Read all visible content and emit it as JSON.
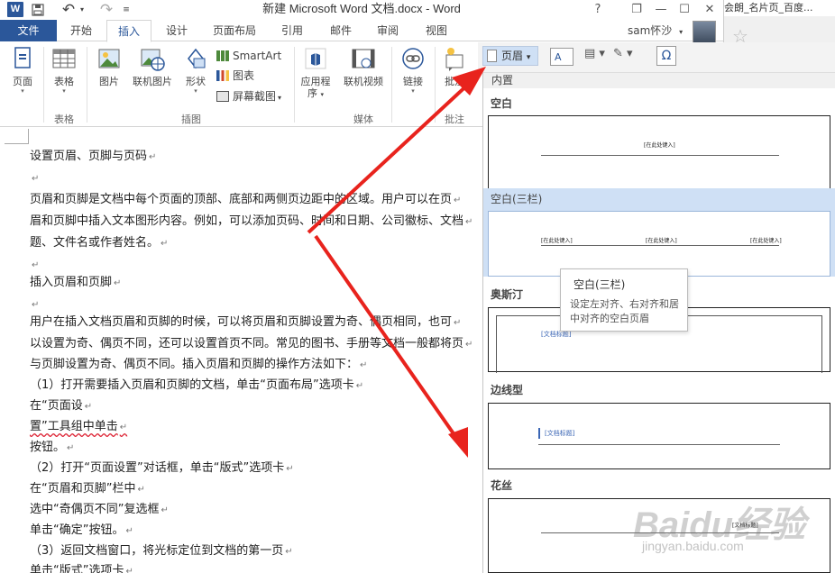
{
  "app": {
    "window_title": "新建 Microsoft Word 文档.docx - Word",
    "logo_letter": "W",
    "undo_glyph": "↶",
    "redo_glyph": "↷",
    "help_glyph": "?",
    "restore_glyph": "❐",
    "minimize_glyph": "—",
    "close_glyph": "✕",
    "right_window_title": "会朗_名片页_百度...",
    "right_window_close": "✕"
  },
  "tabs": {
    "file": "文件",
    "items": [
      "开始",
      "插入",
      "设计",
      "页面布局",
      "引用",
      "邮件",
      "审阅",
      "视图"
    ],
    "active": "插入",
    "user_name": "sam怀沙"
  },
  "ribbon": {
    "page": "页面",
    "table": "表格",
    "picture": "图片",
    "online_picture": "联机图片",
    "shapes": "形状",
    "smartart": "SmartArt",
    "chart": "图表",
    "screenshot": "屏幕截图",
    "apps": "应用程",
    "apps2": "序",
    "online_video": "联机视频",
    "link": "链接",
    "comment": "批注",
    "groups": {
      "tables": "表格",
      "illustrations": "插图",
      "media": "媒体",
      "comments": "批注"
    }
  },
  "header_dropdown": {
    "label": "页眉",
    "caret": "▾"
  },
  "document": {
    "lines": [
      "设置页眉、页脚与页码",
      "",
      "页眉和页脚是文档中每个页面的顶部、底部和两侧页边距中的区域。用户可以在页",
      "眉和页脚中插入文本图形内容。例如，可以添加页码、时间和日期、公司徽标、文档",
      "题、文件名或作者姓名。",
      "",
      "插入页眉和页脚",
      "",
      "用户在插入文档页眉和页脚的时候，可以将页眉和页脚设置为奇、偶页相同，也可",
      "以设置为奇、偶页不同，还可以设置首页不同。常见的图书、手册等文档一般都将页",
      "与页脚设置为奇、偶页不同。插入页眉和页脚的操作方法如下：",
      "（1）打开需要插入页眉和页脚的文档，单击“页面布局”选项卡",
      "在“页面设",
      "置”工具组中单击",
      "按钮。",
      "（2）打开“页面设置”对话框，单击“版式”选项卡",
      "在“页眉和页脚”栏中",
      "选中“奇偶页不同”复选框",
      "单击“确定”按钮。",
      "（3）返回文档窗口，将光标定位到文档的第一页",
      "单击“版式”选项卡"
    ],
    "paragraph_mark": "↵"
  },
  "gallery": {
    "builtin": "内置",
    "sections": [
      {
        "name": "空白",
        "placeholder": "[在此处键入]"
      },
      {
        "name": "空白(三栏)",
        "placeholder": "[在此处键入]"
      },
      {
        "name": "奥斯汀",
        "placeholder": "[文档标题]"
      },
      {
        "name": "边线型",
        "placeholder": "[文档标题]"
      },
      {
        "name": "花丝",
        "placeholder": "[文档标题]"
      }
    ]
  },
  "tooltip": {
    "title": "空白(三栏)",
    "description": "设定左对齐、右对齐和居中对齐的空白页眉"
  },
  "watermark": {
    "brand": "Baidu经验",
    "url": "jingyan.baidu.com"
  },
  "colors": {
    "brand_blue": "#2b579a",
    "highlight": "#cfe0f5",
    "arrow_red": "#e8231d"
  }
}
